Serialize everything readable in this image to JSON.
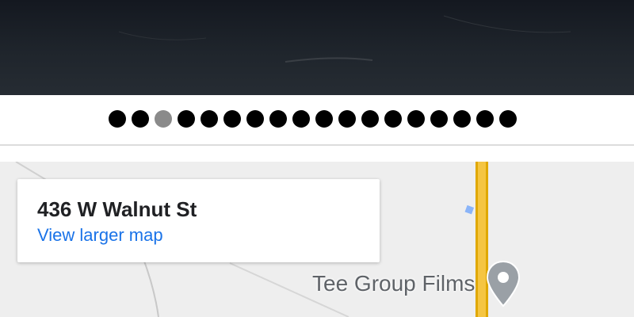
{
  "carousel": {
    "dot_count": 18,
    "active_index": 2
  },
  "map": {
    "card": {
      "address": "436 W Walnut St",
      "link_label": "View larger map"
    },
    "place": {
      "label": "Tee Group Films",
      "icon": "map-pin-icon"
    },
    "colors": {
      "background": "#eeeeee",
      "road_major": "#f5c542",
      "link": "#1a73e8",
      "pin": "#9aa0a6"
    }
  }
}
